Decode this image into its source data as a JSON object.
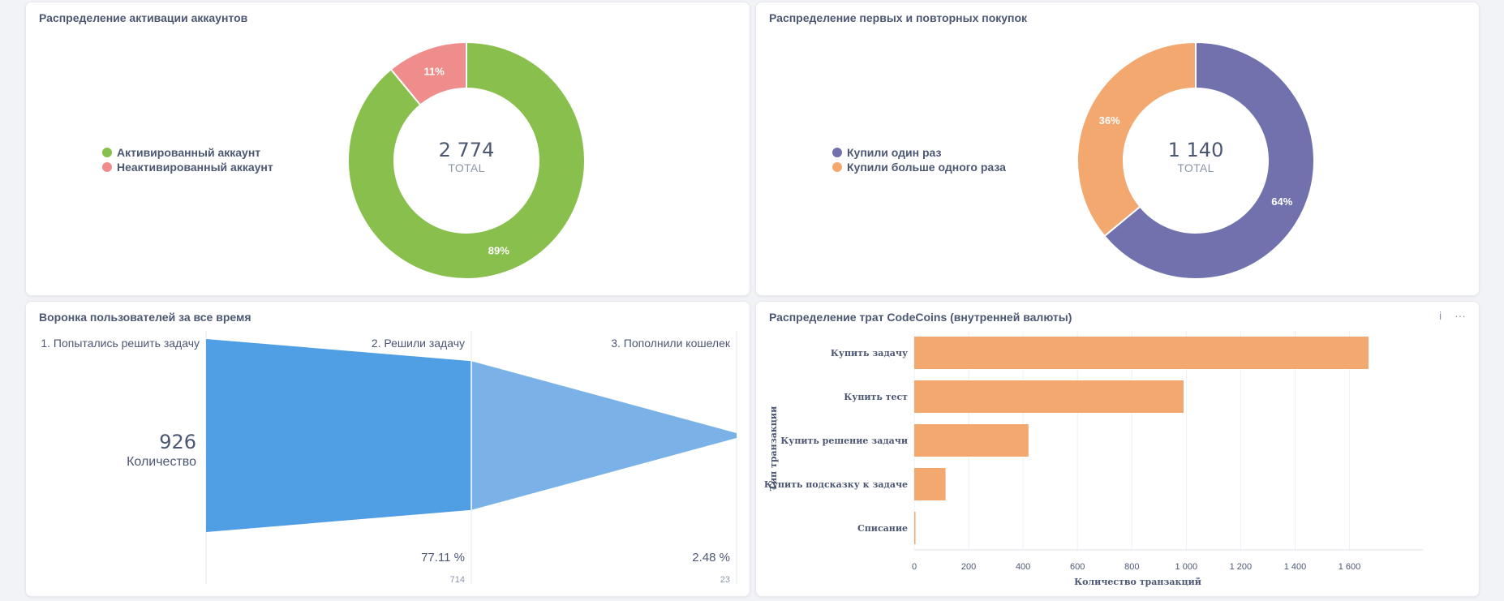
{
  "cards": {
    "activation": {
      "title": "Распределение активации аккаунтов",
      "total": "2 774",
      "total_label": "TOTAL",
      "legend": [
        "Активированный аккаунт",
        "Неактивированный аккаунт"
      ],
      "slices_labels": [
        "89%",
        "11%"
      ]
    },
    "purchases": {
      "title": "Распределение первых и повторных покупок",
      "total": "1 140",
      "total_label": "TOTAL",
      "legend": [
        "Купили один раз",
        "Купили больше одного раза"
      ],
      "slices_labels": [
        "64%",
        "36%"
      ]
    },
    "funnel": {
      "title": "Воронка пользователей за все время",
      "steps": [
        "1. Попытались решить задачу",
        "2. Решили задачу",
        "3. Пополнили кошелек"
      ],
      "big_value": "926",
      "big_label": "Количество",
      "percents": [
        "77.11 %",
        "2.48 %"
      ],
      "counts": [
        "714",
        "23"
      ]
    },
    "spend": {
      "title": "Распределение трат CodeCoins (внутренней валюты)",
      "icons": [
        "info-icon",
        "more-icon"
      ],
      "icon_glyphs": {
        "info": "i",
        "more": "···"
      }
    }
  },
  "chart_data": [
    {
      "type": "pie",
      "title": "Распределение активации аккаунтов",
      "categories": [
        "Активированный аккаунт",
        "Неактивированный аккаунт"
      ],
      "values": [
        0.89,
        0.11
      ],
      "colors": [
        "#88bf4d",
        "#ef8c8c"
      ],
      "total": 2774,
      "legend": "left"
    },
    {
      "type": "pie",
      "title": "Распределение первых и повторных покупок",
      "categories": [
        "Купили один раз",
        "Купили больше одного раза"
      ],
      "values": [
        0.64,
        0.36
      ],
      "colors": [
        "#7172ad",
        "#f2a86f"
      ],
      "total": 1140,
      "legend": "left"
    },
    {
      "type": "bar",
      "title": "Воронка пользователей за все время",
      "categories": [
        "1. Попытались решить задачу",
        "2. Решили задачу",
        "3. Пополнили кошелек"
      ],
      "values": [
        926,
        714,
        23
      ],
      "colors": [
        "#509ee3",
        "#7ab2e8"
      ]
    },
    {
      "type": "bar",
      "orientation": "horizontal",
      "title": "Распределение трат CodeCoins (внутренней валюты)",
      "categories": [
        "Купить задачу",
        "Купить тест",
        "Купить решение задачи",
        "Купить подсказку к задаче",
        "Списание"
      ],
      "values": [
        1670,
        990,
        420,
        115,
        3
      ],
      "xlabel": "Количество транзакций",
      "ylabel": "Тип транзакции",
      "xlim": [
        0,
        1600
      ],
      "xticks": [
        "0",
        "200",
        "400",
        "600",
        "800",
        "1 000",
        "1 200",
        "1 400",
        "1 600"
      ],
      "grid": true,
      "color": "#f2a86f"
    }
  ]
}
